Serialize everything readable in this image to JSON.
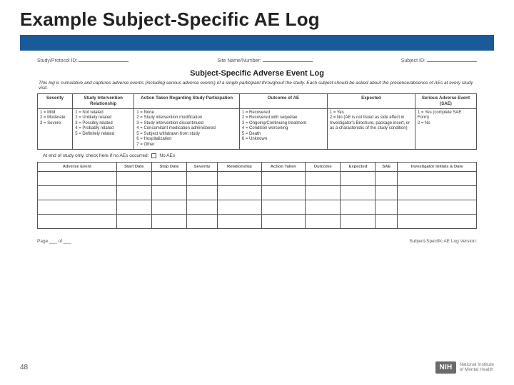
{
  "slide": {
    "title": "Example Subject-Specific AE Log",
    "page_number": "48",
    "nih_abbr": "NIH",
    "nih_line1": "National Institute",
    "nih_line2": "of Mental Health"
  },
  "doc": {
    "header_fields": {
      "study": "Study/Protocol ID:",
      "site": "Site Name/Number:",
      "subject": "Subject ID:"
    },
    "title": "Subject-Specific Adverse Event Log",
    "intro": "This log is cumulative and captures adverse events (including serious adverse events) of a single participant throughout the study. Each subject should be asked about the presence/absence of AEs at every study visit.",
    "key": {
      "headers": {
        "severity": "Severity",
        "relationship": "Study Intervention Relationship",
        "action": "Action Taken Regarding Study Participation",
        "outcome": "Outcome of AE",
        "expected": "Expected",
        "sae": "Serious Adverse Event (SAE)"
      },
      "severity": "1 = Mild\n2 = Moderate\n3 = Severe",
      "relationship": "1 = Not related\n2 = Unlikely related\n3 = Possibly related\n4 = Probably related\n5 = Definitely related",
      "action": "1 = None\n2 = Study intervention modification\n3 = Study intervention discontinued\n4 = Concomitant medication administered\n5 = Subject withdrawn from study\n6 = Hospitalization\n7 = Other",
      "outcome": "1 = Recovered\n2 = Recovered with sequelae\n3 = Ongoing/Continuing treatment\n4 = Condition worsening\n5 = Death\n6 = Unknown",
      "expected": "1 = Yes\n2 = No (AE is not listed as side effect in Investigator's Brochure, package insert, or as a characteristic of the study condition)",
      "sae": "1 = Yes (complete SAE Form)\n2 = No"
    },
    "end_study": {
      "label": "At end of study only, check here if no AEs occurred:",
      "box_label": "No AEs"
    },
    "log_headers": {
      "event": "Adverse Event",
      "start": "Start Date",
      "stop": "Stop Date",
      "severity": "Severity",
      "relationship": "Relationship",
      "action": "Action Taken",
      "outcome": "Outcome",
      "expected": "Expected",
      "sae": "SAE",
      "initials": "Investigator Initials & Date"
    },
    "footer": {
      "page": "Page ___ of ___",
      "version": "Subject-Specific AE Log Version:"
    }
  }
}
